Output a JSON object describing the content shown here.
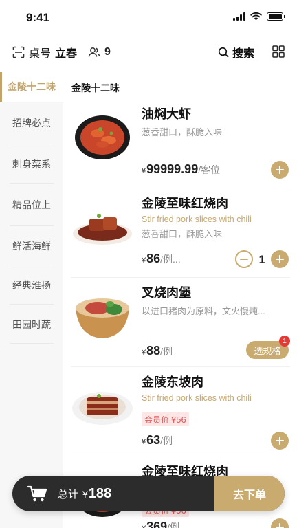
{
  "status_bar": {
    "time": "9:41"
  },
  "header": {
    "table_label": "桌号",
    "table_name": "立春",
    "people_count": "9",
    "search_label": "搜索"
  },
  "sidebar": {
    "items": [
      {
        "label": "金陵十二味",
        "active": true
      },
      {
        "label": "招牌必点"
      },
      {
        "label": "刺身菜系"
      },
      {
        "label": "精品位上"
      },
      {
        "label": "鲜活海鲜"
      },
      {
        "label": "经典淮扬"
      },
      {
        "label": "田园时蔬"
      }
    ]
  },
  "section_title": "金陵十二味",
  "dishes": [
    {
      "name": "油焖大虾",
      "desc": "葱香甜口，酥脆入味",
      "currency": "¥",
      "price": "99999.99",
      "unit": "/客位",
      "action": "add"
    },
    {
      "name": "金陵至味红烧肉",
      "en": "Stir fried pork slices with chili",
      "desc": "葱香甜口，酥脆入味",
      "currency": "¥",
      "price": "86",
      "unit": "/例...",
      "quantity": "1",
      "action": "stepper"
    },
    {
      "name": "叉烧肉堡",
      "desc": "以进口猪肉为原料，文火慢炖...",
      "currency": "¥",
      "price": "88",
      "unit": "/例",
      "spec_label": "选规格",
      "spec_badge": "1",
      "action": "spec"
    },
    {
      "name": "金陵东坡肉",
      "en": "Stir fried pork slices with chili",
      "member_label": "会员价",
      "member_price": "¥56",
      "currency": "¥",
      "price": "63",
      "unit": "/例",
      "action": "add"
    },
    {
      "name": "金陵至味红烧肉",
      "member_label": "会员价",
      "member_price": "¥56",
      "currency": "¥",
      "price": "369",
      "unit": "/例",
      "action": "add"
    }
  ],
  "cart": {
    "total_label": "总计",
    "currency": "¥",
    "total": "188",
    "checkout_label": "去下单"
  },
  "colors": {
    "accent": "#c9ab6f",
    "cart_bg": "#2c2c2c",
    "badge_red": "#e53935"
  }
}
